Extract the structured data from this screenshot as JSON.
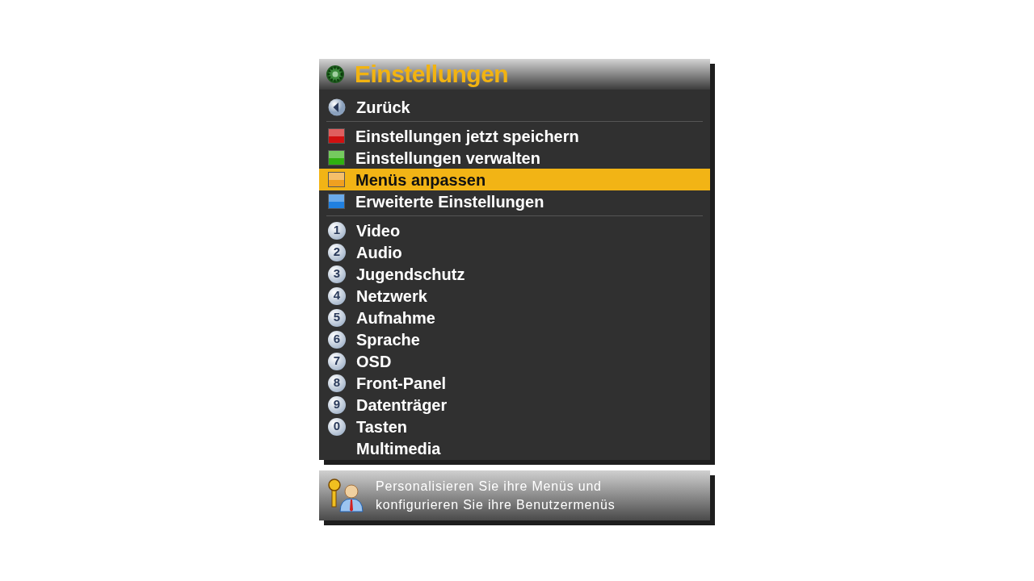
{
  "title": "Einstellungen",
  "sections": [
    {
      "items": [
        {
          "kind": "back",
          "label": "Zurück",
          "selected": false
        }
      ]
    },
    {
      "items": [
        {
          "kind": "color",
          "color": "#d01010",
          "label": "Einstellungen jetzt speichern",
          "selected": false
        },
        {
          "kind": "color",
          "color": "#30b010",
          "label": "Einstellungen verwalten",
          "selected": false
        },
        {
          "kind": "color",
          "color": "#f0a020",
          "label": "Menüs anpassen",
          "selected": true
        },
        {
          "kind": "color",
          "color": "#2080e0",
          "label": "Erweiterte Einstellungen",
          "selected": false
        }
      ]
    },
    {
      "items": [
        {
          "kind": "number",
          "key": "1",
          "label": "Video",
          "selected": false
        },
        {
          "kind": "number",
          "key": "2",
          "label": "Audio",
          "selected": false
        },
        {
          "kind": "number",
          "key": "3",
          "label": "Jugendschutz",
          "selected": false
        },
        {
          "kind": "number",
          "key": "4",
          "label": "Netzwerk",
          "selected": false
        },
        {
          "kind": "number",
          "key": "5",
          "label": "Aufnahme",
          "selected": false
        },
        {
          "kind": "number",
          "key": "6",
          "label": "Sprache",
          "selected": false
        },
        {
          "kind": "number",
          "key": "7",
          "label": "OSD",
          "selected": false
        },
        {
          "kind": "number",
          "key": "8",
          "label": "Front-Panel",
          "selected": false
        },
        {
          "kind": "number",
          "key": "9",
          "label": "Datenträger",
          "selected": false
        },
        {
          "kind": "number",
          "key": "0",
          "label": "Tasten",
          "selected": false
        },
        {
          "kind": "plain",
          "label": "Multimedia",
          "selected": false
        }
      ]
    }
  ],
  "description": {
    "lines": [
      "Personalisieren Sie ihre Menüs und",
      "konfigurieren Sie ihre Benutzermenüs"
    ]
  }
}
